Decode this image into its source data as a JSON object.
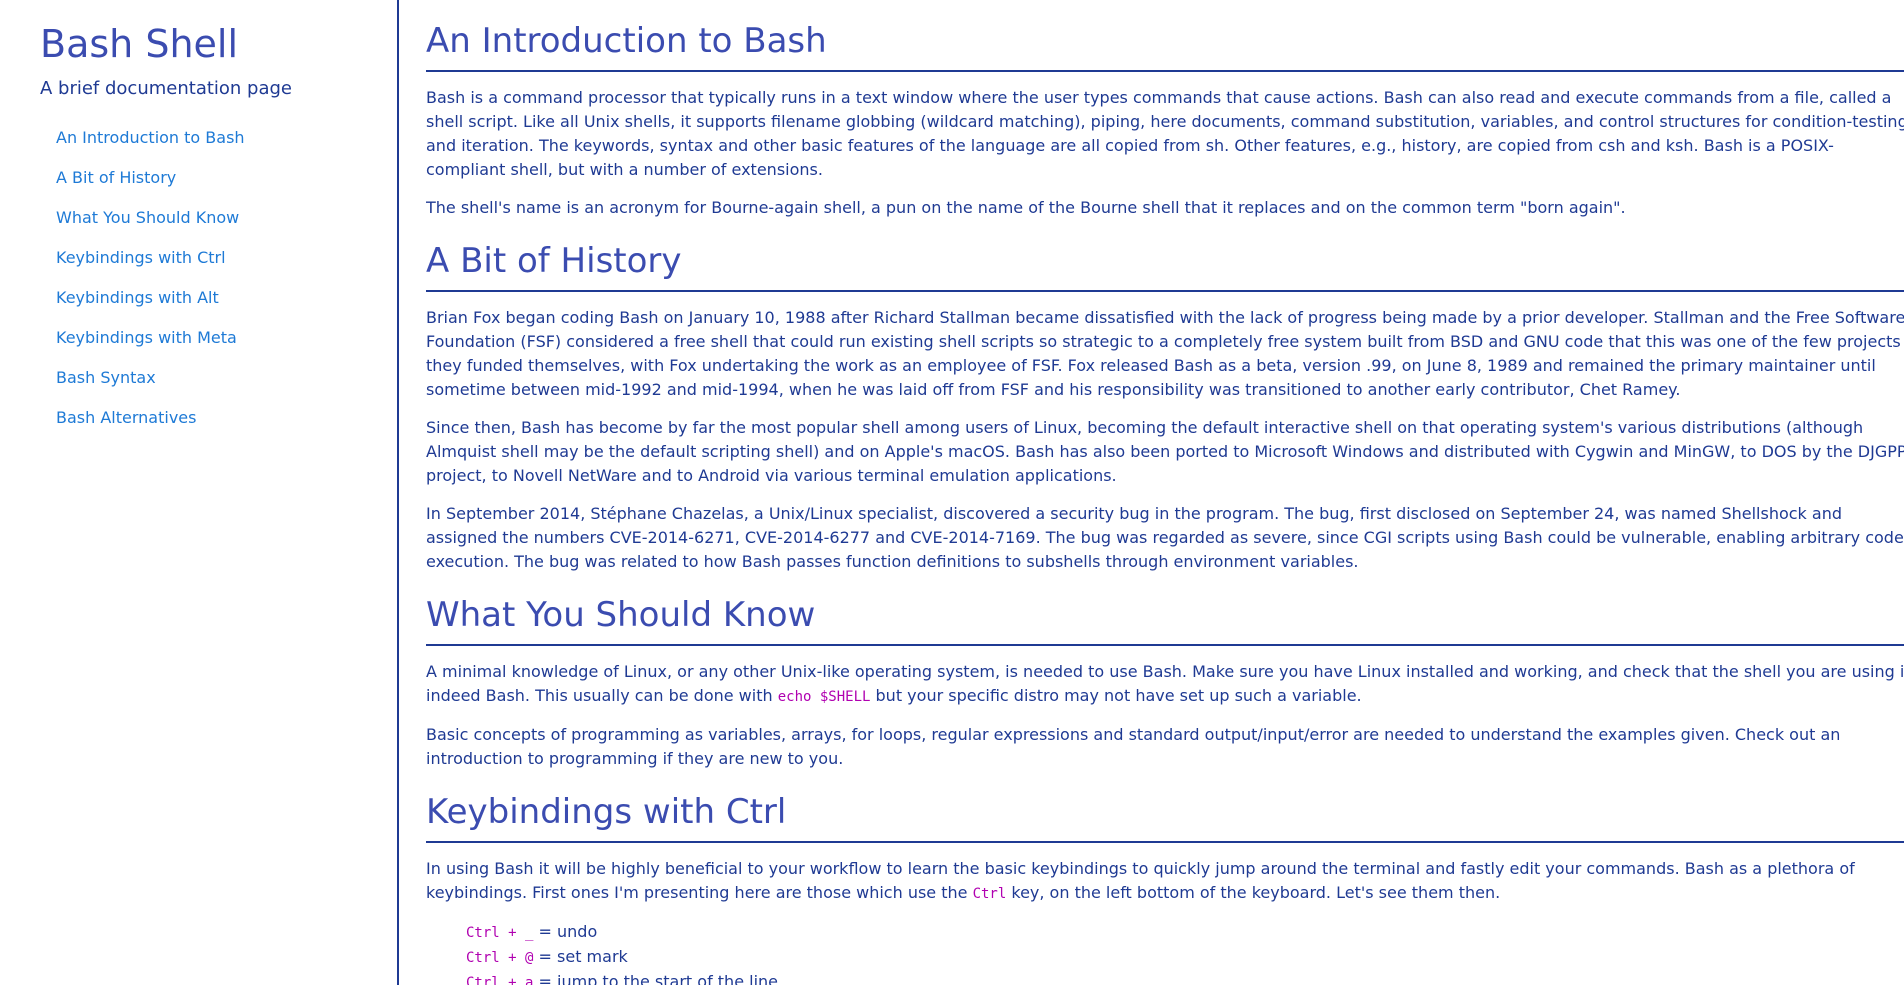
{
  "sidebar": {
    "title": "Bash Shell",
    "subtitle": "A brief documentation page",
    "nav": [
      "An Introduction to Bash",
      "A Bit of History",
      "What You Should Know",
      "Keybindings with Ctrl",
      "Keybindings with Alt",
      "Keybindings with Meta",
      "Bash Syntax",
      "Bash Alternatives"
    ]
  },
  "sections": {
    "intro": {
      "heading": "An Introduction to Bash",
      "p1": [
        "Bash is a command processor that typically runs in a text window where the user types commands that cause actions. Bash can also read and execute commands from a file, called a",
        "shell script. Like all Unix shells, it supports filename globbing (wildcard matching), piping, here documents, command substitution, variables, and control structures for condition-testing",
        "and iteration. The keywords, syntax and other basic features of the language are all copied from sh. Other features, e.g., history, are copied from csh and ksh. Bash is a POSIX-",
        "compliant shell, but with a number of extensions."
      ],
      "p2": "The shell's name is an acronym for Bourne-again shell, a pun on the name of the Bourne shell that it replaces and on the common term \"born again\"."
    },
    "history": {
      "heading": "A Bit of History",
      "p1": [
        "Brian Fox began coding Bash on January 10, 1988 after Richard Stallman became dissatisfied with the lack of progress being made by a prior developer. Stallman and the Free Software",
        "Foundation (FSF) considered a free shell that could run existing shell scripts so strategic to a completely free system built from BSD and GNU code that this was one of the few projects",
        "they funded themselves, with Fox undertaking the work as an employee of FSF. Fox released Bash as a beta, version .99, on June 8, 1989 and remained the primary maintainer until",
        "sometime between mid-1992 and mid-1994, when he was laid off from FSF and his responsibility was transitioned to another early contributor, Chet Ramey."
      ],
      "p2": [
        "Since then, Bash has become by far the most popular shell among users of Linux, becoming the default interactive shell on that operating system's various distributions (although",
        "Almquist shell may be the default scripting shell) and on Apple's macOS. Bash has also been ported to Microsoft Windows and distributed with Cygwin and MinGW, to DOS by the DJGPP",
        "project, to Novell NetWare and to Android via various terminal emulation applications."
      ],
      "p3": [
        "In September 2014, Stéphane Chazelas, a Unix/Linux specialist, discovered a security bug in the program. The bug, first disclosed on September 24, was named Shellshock and",
        "assigned the numbers CVE-2014-6271, CVE-2014-6277 and CVE-2014-7169. The bug was regarded as severe, since CGI scripts using Bash could be vulnerable, enabling arbitrary code",
        "execution. The bug was related to how Bash passes function definitions to subshells through environment variables."
      ]
    },
    "know": {
      "heading": "What You Should Know",
      "p1_line1": "A minimal knowledge of Linux, or any other Unix-like operating system, is needed to use Bash. Make sure you have Linux installed and working, and check that the shell you are using is",
      "p1_line2_before": "indeed Bash. This usually can be done with ",
      "p1_code": "echo $SHELL",
      "p1_line2_after": " but your specific distro may not have set up such a variable.",
      "p2": [
        "Basic concepts of programming as variables, arrays, for loops, regular expressions and standard output/input/error are needed to understand the examples given. Check out an",
        "introduction to programming if they are new to you."
      ]
    },
    "ctrl": {
      "heading": "Keybindings with Ctrl",
      "p1_line1": "In using Bash it will be highly beneficial to your workflow to learn the basic keybindings to quickly jump around the terminal and fastly edit your commands. Bash as a plethora of",
      "p1_line2_before": "keybindings. First ones I'm presenting here are those which use the ",
      "p1_code": "Ctrl",
      "p1_line2_after": " key, on the left bottom of the keyboard. Let's see them then.",
      "keys": [
        {
          "combo": "Ctrl + _",
          "action": " = undo"
        },
        {
          "combo": "Ctrl + @",
          "action": " = set mark"
        },
        {
          "combo": "Ctrl + a",
          "action": " = jump to the start of the line"
        }
      ]
    }
  },
  "colors": {
    "heading": "#3b4cb0",
    "text": "#1f3a93",
    "link": "#1e7ad6",
    "code": "#b000b0"
  }
}
